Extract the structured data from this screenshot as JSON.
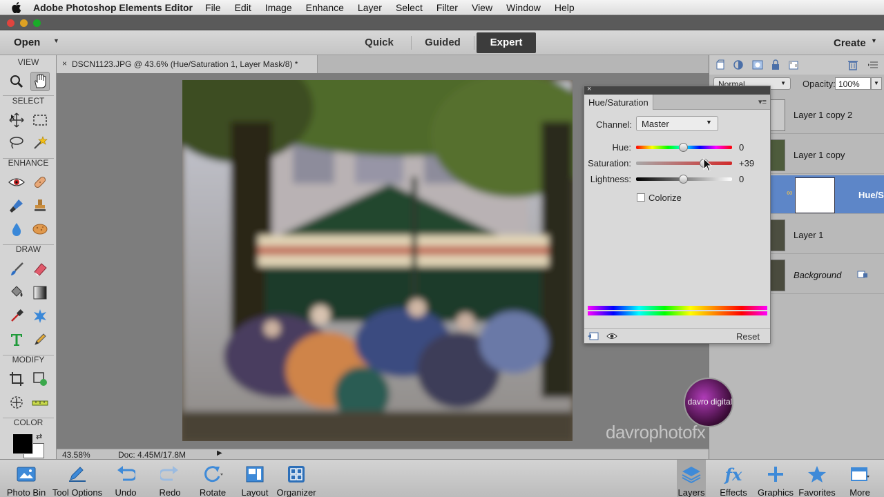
{
  "menubar": {
    "app_name": "Adobe Photoshop Elements Editor",
    "items": [
      "File",
      "Edit",
      "Image",
      "Enhance",
      "Layer",
      "Select",
      "Filter",
      "View",
      "Window",
      "Help"
    ]
  },
  "modebar": {
    "open_label": "Open",
    "tabs": [
      {
        "label": "Quick",
        "active": false
      },
      {
        "label": "Guided",
        "active": false
      },
      {
        "label": "Expert",
        "active": true
      }
    ],
    "create_label": "Create"
  },
  "toolbox": {
    "sections": [
      "VIEW",
      "SELECT",
      "ENHANCE",
      "DRAW",
      "MODIFY",
      "COLOR"
    ],
    "tools": [
      "zoom",
      "hand",
      "move",
      "marquee",
      "lasso",
      "magic-wand",
      "red-eye",
      "healing-brush",
      "smart-brush",
      "clone-stamp",
      "blur",
      "sponge",
      "brush",
      "eraser",
      "paint-bucket",
      "gradient",
      "eyedropper",
      "custom-shape",
      "type",
      "pencil",
      "crop",
      "recompose",
      "content-aware-move",
      "straighten"
    ],
    "foreground_color": "#000000",
    "background_color": "#ffffff"
  },
  "document": {
    "tab_title": "DSCN1123.JPG @ 43.6% (Hue/Saturation 1, Layer Mask/8) *",
    "zoom": "43.58%",
    "doc_size": "Doc: 4.45M/17.8M"
  },
  "layers": {
    "blend_mode": "Normal",
    "opacity_label": "Opacity:",
    "opacity_value": "100%",
    "rows": [
      {
        "name": "Layer 1 copy 2",
        "selected": false
      },
      {
        "name": "Layer 1 copy",
        "selected": false
      },
      {
        "name": "Hue/S...",
        "selected": true
      },
      {
        "name": "Layer 1",
        "selected": false
      },
      {
        "name": "Background",
        "selected": false
      }
    ]
  },
  "hue_sat": {
    "title": "Hue/Saturation",
    "channel_label": "Channel:",
    "channel_value": "Master",
    "hue_label": "Hue:",
    "hue_value": "0",
    "saturation_label": "Saturation:",
    "saturation_value": "+39",
    "lightness_label": "Lightness:",
    "lightness_value": "0",
    "colorize_label": "Colorize",
    "colorize_checked": false,
    "reset_label": "Reset"
  },
  "watermark": {
    "logo_text": "davro digital",
    "text": "davrophotofx"
  },
  "taskbar": {
    "left": [
      "Photo Bin",
      "Tool Options",
      "Undo",
      "Redo",
      "Rotate",
      "Layout",
      "Organizer"
    ],
    "right": [
      "Layers",
      "Effects",
      "Graphics",
      "Favorites",
      "More"
    ],
    "active": "Layers"
  },
  "colors": {
    "accent_selected": "#5d86c8",
    "expert_tab_bg": "#3c3c3c"
  }
}
